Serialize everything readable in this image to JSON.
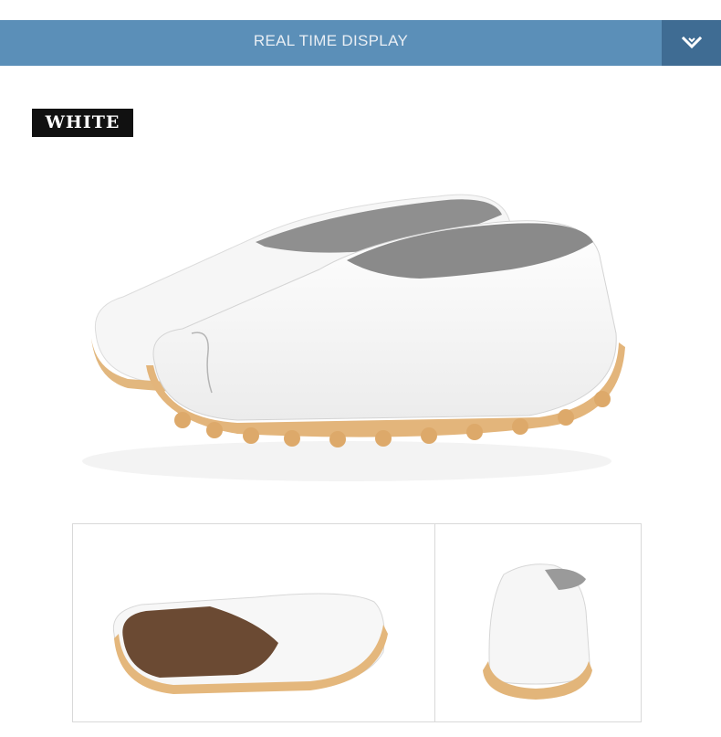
{
  "header": {
    "title": "REAL TIME DISPLAY",
    "toggle_icon": "chevron-down-icon",
    "colors": {
      "bar": "#5b8fb8",
      "toggle": "#3f6c93"
    }
  },
  "product": {
    "color_label": "WHITE"
  },
  "images": {
    "main": "white-loafers-pair",
    "thumb_left": "loafer-side-view",
    "thumb_right": "loafer-heel-view"
  }
}
